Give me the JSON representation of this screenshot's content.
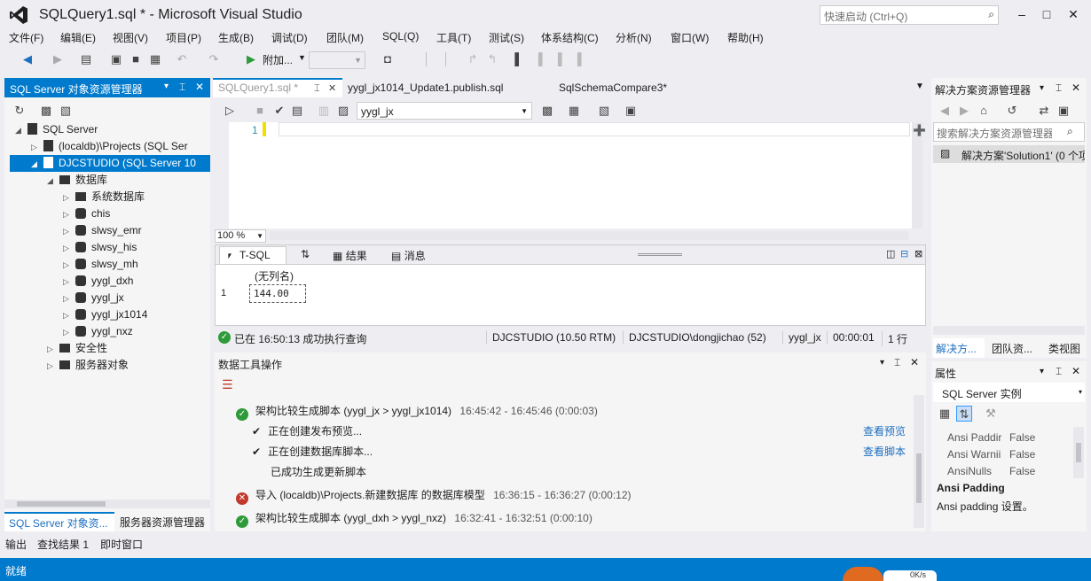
{
  "window": {
    "title": "SQLQuery1.sql * - Microsoft Visual Studio",
    "quick_launch_placeholder": "快速启动 (Ctrl+Q)"
  },
  "menu": [
    "文件(F)",
    "编辑(E)",
    "视图(V)",
    "项目(P)",
    "生成(B)",
    "调试(D)",
    "团队(M)",
    "SQL(Q)",
    "工具(T)",
    "测试(S)",
    "体系结构(C)",
    "分析(N)",
    "窗口(W)",
    "帮助(H)"
  ],
  "toolbar": {
    "attach_label": "附加...",
    "empty_combo": ""
  },
  "left_panel": {
    "title": "SQL Server 对象资源管理器",
    "tree": {
      "root": "SQL Server",
      "server1": "(localdb)\\Projects (SQL Ser",
      "server2": "DJCSTUDIO (SQL Server 10",
      "databases": "数据库",
      "system_db": "系统数据库",
      "dbs": [
        "chis",
        "slwsy_emr",
        "slwsy_his",
        "slwsy_mh",
        "yygl_dxh",
        "yygl_jx",
        "yygl_jx1014",
        "yygl_nxz"
      ],
      "security": "安全性",
      "server_objects": "服务器对象"
    },
    "bottom_tab_active": "SQL Server 对象资...",
    "bottom_tab_2": "服务器资源管理器"
  },
  "doc_tabs": {
    "tab1": "SQLQuery1.sql *",
    "tab2": "yygl_jx1014_Update1.publish.sql",
    "tab3": "SqlSchemaCompare3*"
  },
  "editor": {
    "database": "yygl_jx",
    "line_number": "1",
    "zoom": "100 %"
  },
  "results": {
    "tab_tsql": "T-SQL",
    "tab_results": "结果",
    "tab_messages": "消息",
    "column_header": "(无列名)",
    "row_number": "1",
    "cell_value": "144.00"
  },
  "query_status": {
    "message": "已在 16:50:13 成功执行查询",
    "server": "DJCSTUDIO (10.50 RTM)",
    "user": "DJCSTUDIO\\dongjichao (52)",
    "database": "yygl_jx",
    "elapsed": "00:00:01",
    "rows": "1 行"
  },
  "data_tools": {
    "title": "数据工具操作",
    "op1_title": "架构比较生成脚本 (yygl_jx > yygl_jx1014)",
    "op1_time": "16:45:42 - 16:45:46 (0:00:03)",
    "op1_step1": "正在创建发布预览...",
    "op1_step1_link": "查看预览",
    "op1_step2": "正在创建数据库脚本...",
    "op1_step2_link": "查看脚本",
    "op1_step3": "已成功生成更新脚本",
    "op2_title": "导入 (localdb)\\Projects.新建数据库 的数据库模型",
    "op2_time": "16:36:15 - 16:36:27 (0:00:12)",
    "op3_title": "架构比较生成脚本 (yygl_dxh > yygl_nxz)",
    "op3_time": "16:32:41 - 16:32:51 (0:00:10)"
  },
  "solution_explorer": {
    "title": "解决方案资源管理器",
    "search_placeholder": "搜索解决方案资源管理器",
    "solution_item": "解决方案'Solution1' (0 个项",
    "tab1": "解决方...",
    "tab2": "团队资...",
    "tab3": "类视图"
  },
  "properties": {
    "title": "属性",
    "object": "SQL Server 实例",
    "rows": [
      {
        "name": "Ansi Paddir",
        "value": "False"
      },
      {
        "name": "Ansi Warnii",
        "value": "False"
      },
      {
        "name": "AnsiNulls",
        "value": "False"
      }
    ],
    "desc_title": "Ansi Padding",
    "desc_text": "Ansi padding 设置。"
  },
  "bottom_tabs": [
    "输出",
    "查找结果 1",
    "即时窗口"
  ],
  "status_bar": {
    "text": "就绪",
    "net_speed": "0K/s"
  },
  "colors": {
    "accent": "#007acc",
    "success": "#2e9a3a",
    "error": "#c1392b"
  }
}
